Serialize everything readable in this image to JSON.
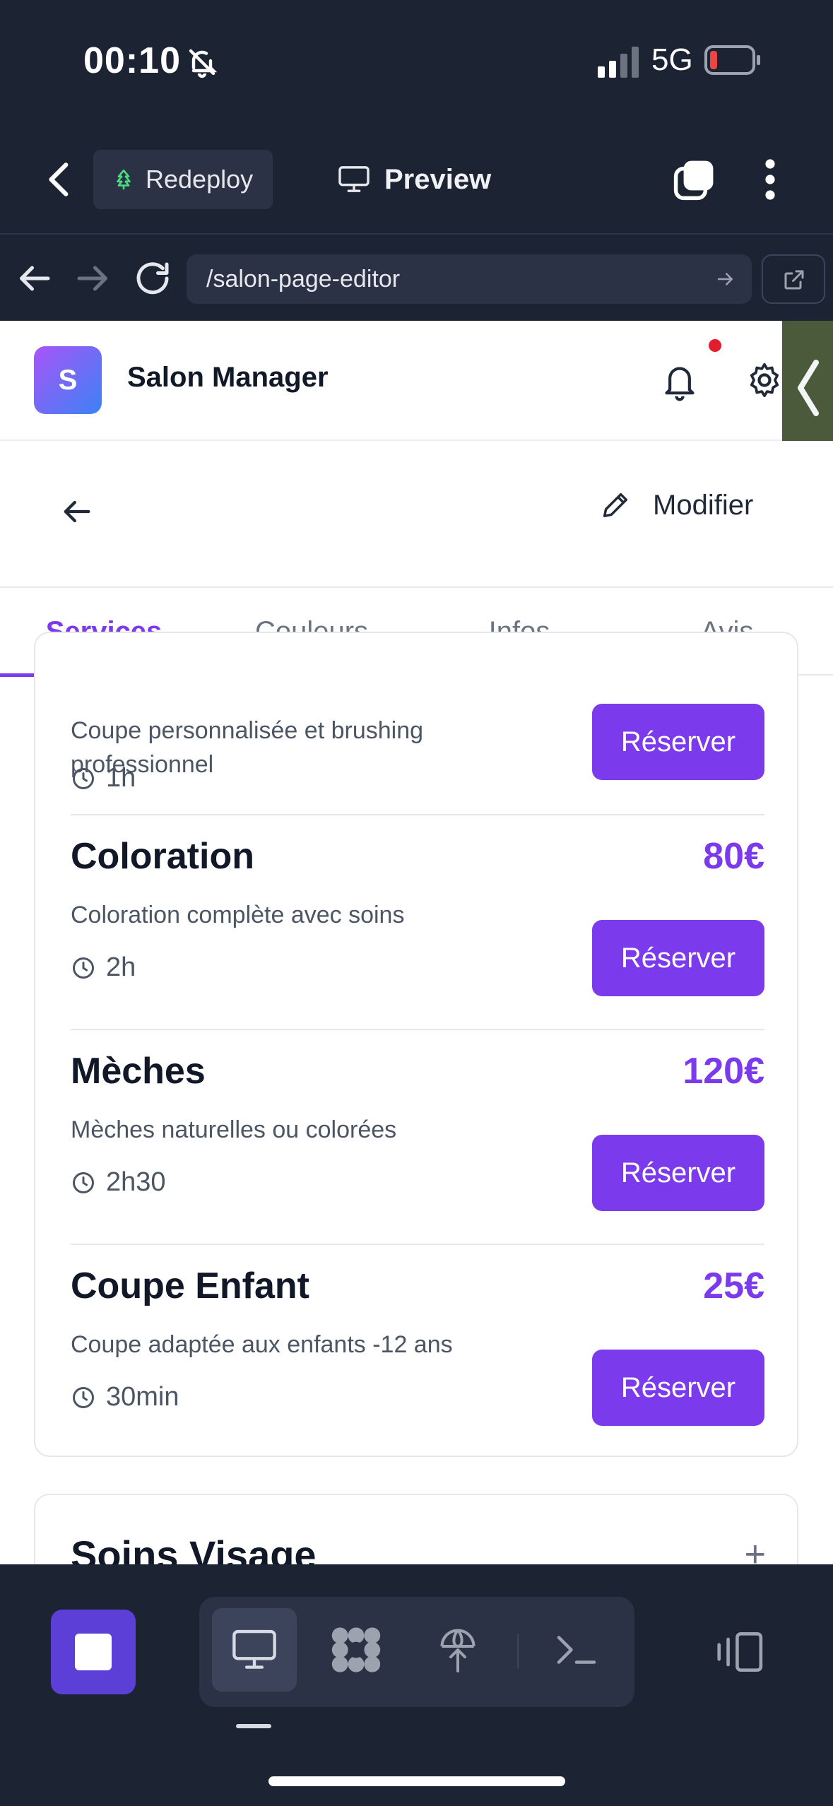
{
  "status": {
    "time": "00:10",
    "network": "5G"
  },
  "toolbar": {
    "redeploy_label": "Redeploy",
    "preview_label": "Preview"
  },
  "urlbar": {
    "url": "/salon-page-editor"
  },
  "app": {
    "logo_letter": "S",
    "name": "Salon Manager",
    "edit_label": "Modifier",
    "tabs": [
      "Services",
      "Couleurs",
      "Infos",
      "Avis"
    ],
    "services": [
      {
        "name": "",
        "price": "",
        "description": "Coupe personnalisée et brushing professionnel",
        "duration": "1h",
        "button": "Réserver"
      },
      {
        "name": "Coloration",
        "price": "80€",
        "description": "Coloration complète avec soins",
        "duration": "2h",
        "button": "Réserver"
      },
      {
        "name": "Mèches",
        "price": "120€",
        "description": "Mèches naturelles ou colorées",
        "duration": "2h30",
        "button": "Réserver"
      },
      {
        "name": "Coupe Enfant",
        "price": "25€",
        "description": "Coupe adaptée aux enfants -12 ans",
        "duration": "30min",
        "button": "Réserver"
      }
    ],
    "next_category": "Soins Visage",
    "next_category_toggle": "+"
  },
  "colors": {
    "accent": "#7c3aed",
    "replit_bg": "#1c2333",
    "notification": "#e11d2e"
  }
}
